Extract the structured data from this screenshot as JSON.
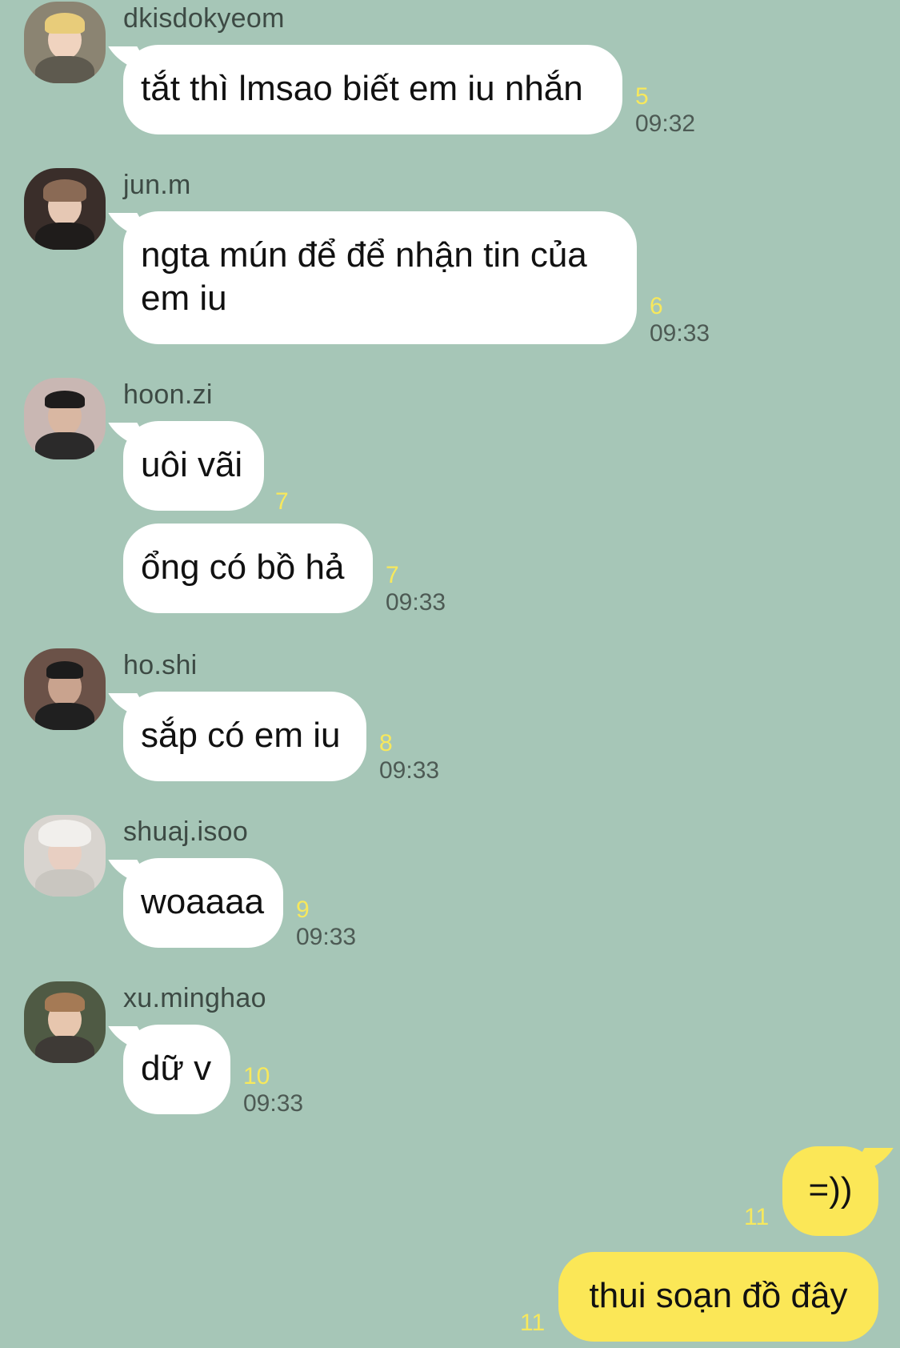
{
  "messages": [
    {
      "sender": "dkisdokyeom",
      "avatar_colors": {
        "bg": "#8b8472",
        "hair": "#e8cc7a",
        "face": "#f0d3bf",
        "body": "#5e5a4f"
      },
      "bubbles": [
        {
          "text": "tắt thì lmsao biết em iu nhắn",
          "count": "5",
          "time": "09:32"
        }
      ]
    },
    {
      "sender": "jun.m",
      "avatar_colors": {
        "bg": "#3a2e2a",
        "hair": "#8a6a55",
        "face": "#e6c8b4",
        "body": "#1f1c1b"
      },
      "bubbles": [
        {
          "text": "ngta mún để để nhận tin của em iu",
          "count": "6",
          "time": "09:33"
        }
      ]
    },
    {
      "sender": "hoon.zi",
      "avatar_colors": {
        "bg": "#c9b7b3",
        "hair": "#1e1c1c",
        "face": "#d9b7a2",
        "body": "#2b2a2a"
      },
      "bubbles": [
        {
          "text": "uôi vãi",
          "count": "7",
          "time": ""
        },
        {
          "text": "ổng có bồ hả",
          "count": "7",
          "time": "09:33"
        }
      ]
    },
    {
      "sender": "ho.shi",
      "avatar_colors": {
        "bg": "#6b5248",
        "hair": "#1c1c1c",
        "face": "#c9a38e",
        "body": "#202020"
      },
      "bubbles": [
        {
          "text": "sắp có em iu",
          "count": "8",
          "time": "09:33"
        }
      ]
    },
    {
      "sender": "shuaj.isoo",
      "avatar_colors": {
        "bg": "#d8d4cf",
        "hair": "#f1efec",
        "face": "#e8cfc2",
        "body": "#c9c6c0"
      },
      "bubbles": [
        {
          "text": "woaaaa",
          "count": "9",
          "time": "09:33"
        }
      ]
    },
    {
      "sender": "xu.minghao",
      "avatar_colors": {
        "bg": "#4f5a44",
        "hair": "#a57a55",
        "face": "#e7c6ae",
        "body": "#3e3a36"
      },
      "bubbles": [
        {
          "text": "dữ v",
          "count": "10",
          "time": "09:33"
        }
      ]
    }
  ],
  "my_messages": [
    {
      "text": "=))",
      "count": "11"
    },
    {
      "text": "thui soạn đồ đây",
      "count": "11"
    }
  ]
}
